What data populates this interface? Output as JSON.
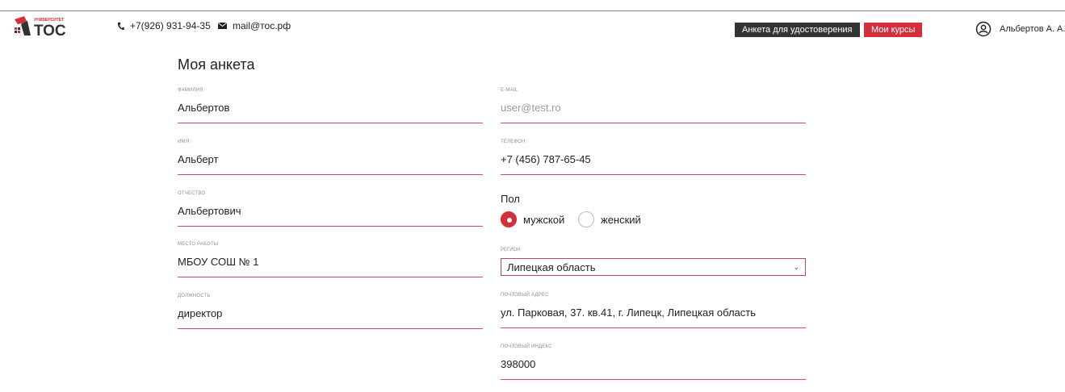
{
  "header": {
    "logo_top": "УНИВЕРСИТЕТ",
    "logo_main": "ТОС",
    "phone": "+7(926) 931-94-35",
    "email": "mail@тос.рф",
    "btn_form": "Анкета для удостоверения",
    "btn_courses": "Мои курсы",
    "user_name": "Альбертов А. А."
  },
  "page": {
    "title": "Моя анкета"
  },
  "fields": {
    "lastname": {
      "label": "фамилия",
      "value": "Альбертов"
    },
    "firstname": {
      "label": "имя",
      "value": "Альберт"
    },
    "patronymic": {
      "label": "отчество",
      "value": "Альбертович"
    },
    "workplace": {
      "label": "место работы",
      "value": "МБОУ СОШ № 1"
    },
    "position": {
      "label": "должность",
      "value": "директор"
    },
    "email": {
      "label": "e-mail",
      "value": "user@test.ro"
    },
    "phone": {
      "label": "телефон",
      "value": "+7 (456) 787-65-45"
    },
    "address": {
      "label": "почтовый адрес",
      "value": "ул. Парковая, 37. кв.41, г. Липецк, Липецкая область"
    },
    "zip": {
      "label": "почтовый индекс",
      "value": "398000"
    }
  },
  "gender": {
    "title": "Пол",
    "male": "мужской",
    "female": "женский",
    "selected": "male"
  },
  "region": {
    "label": "регион",
    "selected": "Липецкая область"
  },
  "colors": {
    "accent": "#d32f3d",
    "dark": "#333333",
    "underline": "#d1485a"
  },
  "icons": [
    "logo-icon",
    "phone-icon",
    "mail-icon",
    "user-icon",
    "chevron-down-icon"
  ]
}
